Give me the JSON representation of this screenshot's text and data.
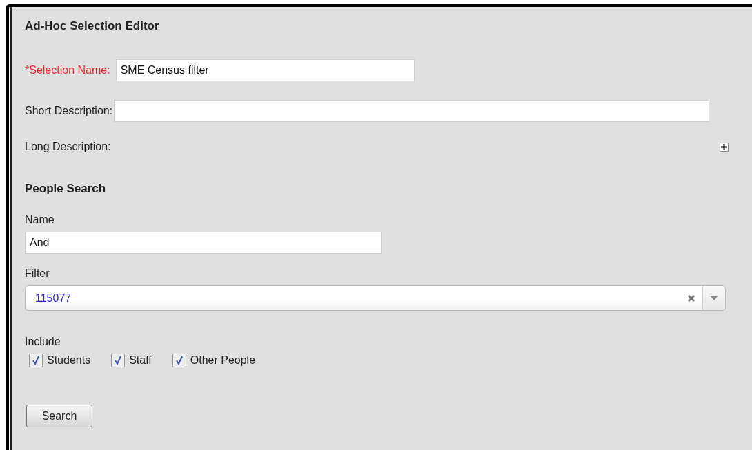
{
  "title": "Ad-Hoc Selection Editor",
  "selection_name": {
    "label": "*Selection Name:",
    "value": "SME Census filter",
    "required": true
  },
  "short_description": {
    "label": "Short Description:"
  },
  "long_description": {
    "label": "Long Description:",
    "expanded": false
  },
  "people_search": {
    "heading": "People Search",
    "name": {
      "label": "Name",
      "value": "And"
    },
    "filter": {
      "label": "Filter",
      "value": "115077"
    },
    "include": {
      "label": "Include",
      "options": [
        {
          "label": "Students",
          "checked": true
        },
        {
          "label": "Staff",
          "checked": true
        },
        {
          "label": "Other People",
          "checked": true
        }
      ]
    },
    "button": "Search"
  }
}
